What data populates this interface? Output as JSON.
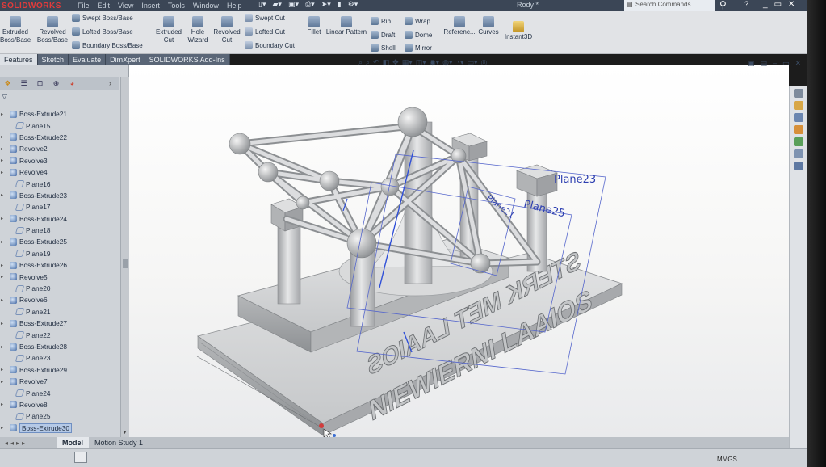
{
  "app": {
    "logo": "SOLIDWORKS",
    "document_title": "Rody *"
  },
  "menu": [
    "File",
    "Edit",
    "View",
    "Insert",
    "Tools",
    "Window",
    "Help"
  ],
  "search": {
    "placeholder": "Search Commands"
  },
  "window_controls": {
    "help": "?",
    "minimize": "_",
    "restore": "▭",
    "close": "✕"
  },
  "command_manager": {
    "extruded_boss": "Extruded Boss/Base",
    "revolved_boss": "Revolved Boss/Base",
    "swept_boss": "Swept Boss/Base",
    "lofted_boss": "Lofted Boss/Base",
    "boundary_boss": "Boundary Boss/Base",
    "extruded_cut": "Extruded Cut",
    "hole_wizard": "Hole Wizard",
    "revolved_cut": "Revolved Cut",
    "swept_cut": "Swept Cut",
    "lofted_cut": "Lofted Cut",
    "boundary_cut": "Boundary Cut",
    "fillet": "Fillet",
    "linear_pattern": "Linear Pattern",
    "rib": "Rib",
    "draft": "Draft",
    "shell": "Shell",
    "wrap": "Wrap",
    "dome": "Dome",
    "mirror": "Mirror",
    "reference": "Referenc...",
    "curves": "Curves",
    "instant3d": "Instant3D"
  },
  "tabs": [
    "Features",
    "Sketch",
    "Evaluate",
    "DimXpert",
    "SOLIDWORKS Add-Ins"
  ],
  "tree": [
    {
      "label": "Boss-Extrude21",
      "kind": "boss",
      "expand": true
    },
    {
      "label": "Plane15",
      "kind": "plane",
      "expand": false
    },
    {
      "label": "Boss-Extrude22",
      "kind": "boss",
      "expand": true
    },
    {
      "label": "Revolve2",
      "kind": "rev",
      "expand": true
    },
    {
      "label": "Revolve3",
      "kind": "rev",
      "expand": true
    },
    {
      "label": "Revolve4",
      "kind": "rev",
      "expand": true
    },
    {
      "label": "Plane16",
      "kind": "plane",
      "expand": false
    },
    {
      "label": "Boss-Extrude23",
      "kind": "boss",
      "expand": true
    },
    {
      "label": "Plane17",
      "kind": "plane",
      "expand": false
    },
    {
      "label": "Boss-Extrude24",
      "kind": "boss",
      "expand": true
    },
    {
      "label": "Plane18",
      "kind": "plane",
      "expand": false
    },
    {
      "label": "Boss-Extrude25",
      "kind": "boss",
      "expand": true
    },
    {
      "label": "Plane19",
      "kind": "plane",
      "expand": false
    },
    {
      "label": "Boss-Extrude26",
      "kind": "boss",
      "expand": true
    },
    {
      "label": "Revolve5",
      "kind": "rev",
      "expand": true
    },
    {
      "label": "Plane20",
      "kind": "plane",
      "expand": false
    },
    {
      "label": "Revolve6",
      "kind": "rev",
      "expand": true
    },
    {
      "label": "Plane21",
      "kind": "plane",
      "expand": false
    },
    {
      "label": "Boss-Extrude27",
      "kind": "boss",
      "expand": true
    },
    {
      "label": "Plane22",
      "kind": "plane",
      "expand": false
    },
    {
      "label": "Boss-Extrude28",
      "kind": "boss",
      "expand": true
    },
    {
      "label": "Plane23",
      "kind": "plane",
      "expand": false
    },
    {
      "label": "Boss-Extrude29",
      "kind": "boss",
      "expand": true
    },
    {
      "label": "Revolve7",
      "kind": "rev",
      "expand": true
    },
    {
      "label": "Plane24",
      "kind": "plane",
      "expand": false
    },
    {
      "label": "Revolve8",
      "kind": "rev",
      "expand": true
    },
    {
      "label": "Plane25",
      "kind": "plane",
      "expand": false
    },
    {
      "label": "Boss-Extrude30",
      "kind": "boss",
      "expand": true,
      "selected": true
    }
  ],
  "viewport": {
    "plane_labels": [
      "Plane23",
      "Plane25",
      "Plane21"
    ],
    "base_text_front": "NIEWIERNI LAAIOS",
    "base_text_back": "STERK MET LAAIOS"
  },
  "bottom_tabs": [
    "Model",
    "Motion Study 1"
  ],
  "status": {
    "units": "MMGS"
  },
  "colors": {
    "accent": "#e13b3b",
    "model": "#c9cbcd",
    "plane": "#5566cc",
    "tab_bar": "#5a6677"
  }
}
